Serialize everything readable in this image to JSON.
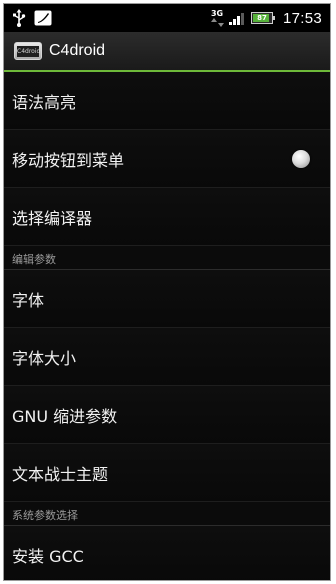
{
  "status_bar": {
    "time": "17:53",
    "network": "3G",
    "battery_text": "87",
    "battery_level": 0.87,
    "icons": [
      "usb-icon",
      "app-notification-icon",
      "signal-icon",
      "battery-icon"
    ]
  },
  "title_bar": {
    "app_icon_text": "C4droid",
    "title": "C4droid"
  },
  "preferences": {
    "syntax_highlight": "语法高亮",
    "move_buttons_to_menu": "移动按钮到菜单",
    "select_compiler": "选择编译器"
  },
  "categories": {
    "editor_params": "编辑参数",
    "system_params": "系统参数选择"
  },
  "editor_items": {
    "font": "字体",
    "font_size": "字体大小",
    "gnu_indent": "GNU 缩进参数",
    "text_warrior_theme": "文本战士主题"
  },
  "system_items": {
    "install_gcc": "安装 GCC"
  },
  "colors": {
    "accent": "#6eb93a",
    "background": "#0b0b0b"
  }
}
